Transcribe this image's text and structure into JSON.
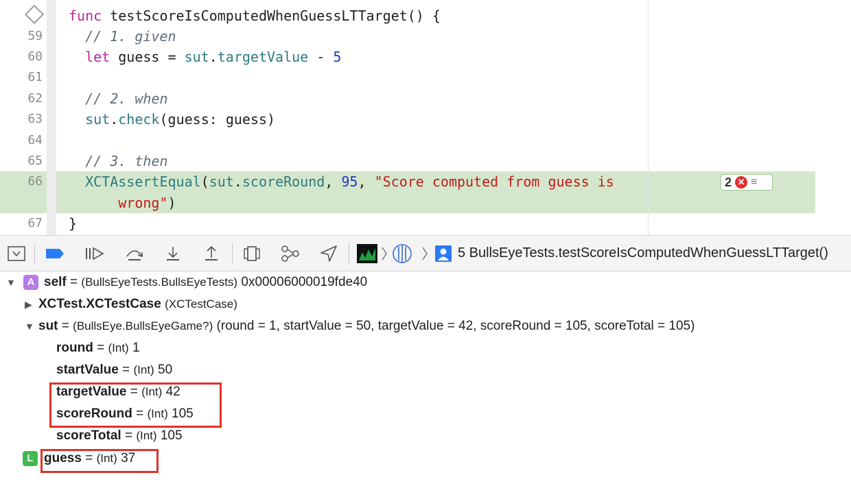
{
  "editor": {
    "lines": [
      {
        "num": "",
        "tokens": [
          {
            "c": "kw",
            "t": "func "
          },
          {
            "c": "plain",
            "t": "testScoreIsComputedWhenGuessLTTarget() {"
          }
        ]
      },
      {
        "num": "59",
        "tokens": [
          {
            "c": "cm",
            "t": "  // 1. given"
          }
        ]
      },
      {
        "num": "60",
        "tokens": [
          {
            "c": "kw",
            "t": "  let "
          },
          {
            "c": "plain",
            "t": "guess = "
          },
          {
            "c": "prop",
            "t": "sut"
          },
          {
            "c": "plain",
            "t": "."
          },
          {
            "c": "prop",
            "t": "targetValue"
          },
          {
            "c": "plain",
            "t": " - "
          },
          {
            "c": "num",
            "t": "5"
          }
        ]
      },
      {
        "num": "61",
        "tokens": []
      },
      {
        "num": "62",
        "tokens": [
          {
            "c": "cm",
            "t": "  // 2. when"
          }
        ]
      },
      {
        "num": "63",
        "tokens": [
          {
            "c": "prop",
            "t": "  sut"
          },
          {
            "c": "plain",
            "t": "."
          },
          {
            "c": "fn",
            "t": "check"
          },
          {
            "c": "plain",
            "t": "(guess: guess)"
          }
        ]
      },
      {
        "num": "64",
        "tokens": []
      },
      {
        "num": "65",
        "tokens": [
          {
            "c": "cm",
            "t": "  // 3. then"
          }
        ]
      },
      {
        "num": "66",
        "tokens": [
          {
            "c": "fn",
            "t": "  XCTAssertEqual"
          },
          {
            "c": "plain",
            "t": "("
          },
          {
            "c": "prop",
            "t": "sut"
          },
          {
            "c": "plain",
            "t": "."
          },
          {
            "c": "prop",
            "t": "scoreRound"
          },
          {
            "c": "plain",
            "t": ", "
          },
          {
            "c": "num",
            "t": "95"
          },
          {
            "c": "plain",
            "t": ", "
          },
          {
            "c": "str",
            "t": "\"Score computed from guess is"
          }
        ]
      },
      {
        "num": "",
        "tokens": [
          {
            "c": "str",
            "t": "      wrong\""
          },
          {
            "c": "plain",
            "t": ")"
          }
        ]
      },
      {
        "num": "67",
        "tokens": [
          {
            "c": "plain",
            "t": "}"
          }
        ]
      }
    ],
    "error_count": "2",
    "error_icon": "x-circle-icon"
  },
  "debug_bar": {
    "breadcrumb": "5 BullsEyeTests.testScoreIsComputedWhenGuessLTTarget()"
  },
  "variables": {
    "self": {
      "badge": "A",
      "name": "self",
      "type": "(BullsEyeTests.BullsEyeTests)",
      "value": "0x00006000019fde40"
    },
    "xctest": {
      "name": "XCTest.XCTestCase",
      "type": "(XCTestCase)"
    },
    "sut": {
      "name": "sut",
      "type": "(BullsEye.BullsEyeGame?)",
      "value": "(round = 1, startValue = 50, targetValue = 42, scoreRound = 105, scoreTotal = 105)"
    },
    "children": [
      {
        "name": "round",
        "type": "(Int)",
        "value": "1"
      },
      {
        "name": "startValue",
        "type": "(Int)",
        "value": "50"
      },
      {
        "name": "targetValue",
        "type": "(Int)",
        "value": "42"
      },
      {
        "name": "scoreRound",
        "type": "(Int)",
        "value": "105"
      },
      {
        "name": "scoreTotal",
        "type": "(Int)",
        "value": "105"
      }
    ],
    "guess": {
      "badge": "L",
      "name": "guess",
      "type": "(Int)",
      "value": "37"
    }
  },
  "colors": {
    "highlight": "#d4e7cc",
    "annotation_box": "#e0322c",
    "keyword": "#b4279f",
    "error": "#e03131"
  }
}
